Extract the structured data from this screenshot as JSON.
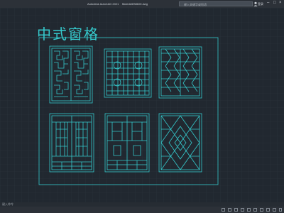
{
  "titlebar": {
    "app": "Autodesk AutoCAD 2021",
    "file": "5bdede6f38b00.dwg",
    "search_placeholder": "键入关键字或短语",
    "login": "登录",
    "minimize_glyph": "–",
    "maximize_glyph": "□",
    "close_glyph": "×"
  },
  "drawing": {
    "title": "中式窗格"
  },
  "command_line": {
    "prompt": "键入命令"
  },
  "colors": {
    "background": "#212830",
    "linework": "#35c9cc",
    "grid": "#2b333c"
  },
  "drawing_panels": [
    "fretwork-panel-1",
    "lattice-panel-2",
    "lattice-panel-3",
    "door-panel-4",
    "door-panel-5",
    "diamond-panel-6"
  ]
}
